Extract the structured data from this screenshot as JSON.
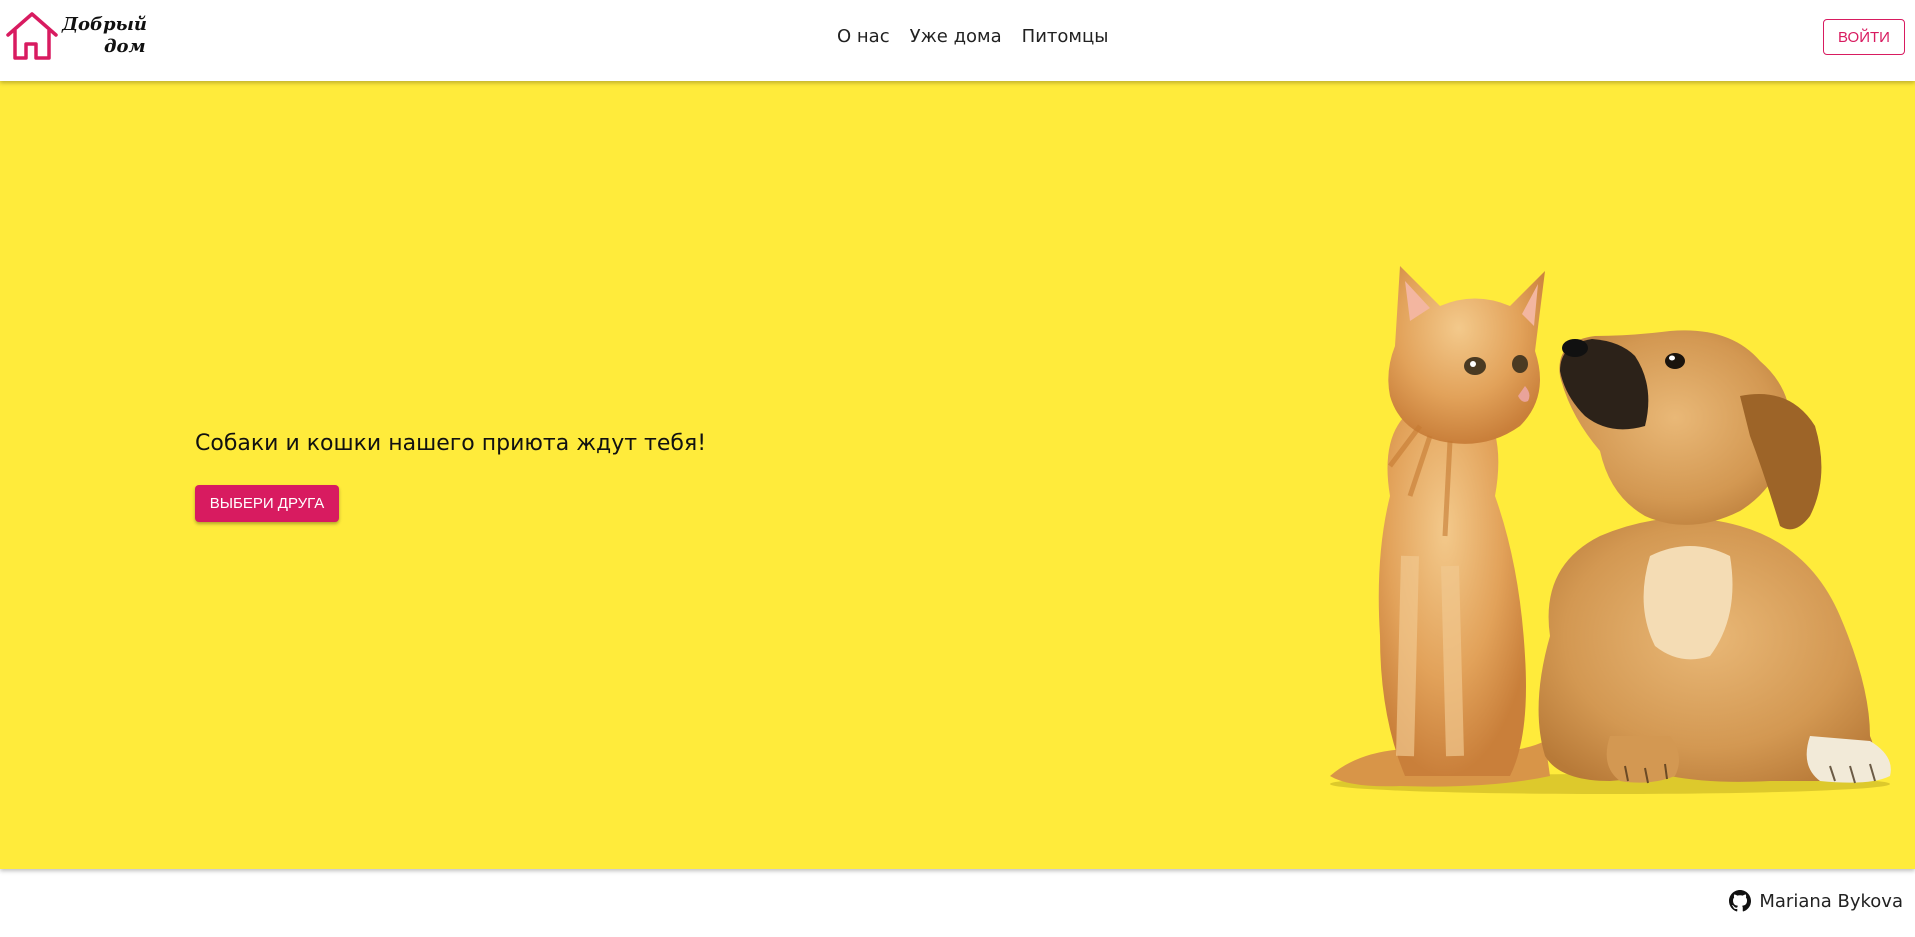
{
  "brand": {
    "line1": "Добрый",
    "line2": "дом",
    "color": "#d81b60"
  },
  "nav": {
    "items": [
      "О нас",
      "Уже дома",
      "Питомцы"
    ]
  },
  "header": {
    "login_label": "ВОЙТИ"
  },
  "hero": {
    "title": "Собаки и кошки нашего приюта ждут тебя!",
    "cta_label": "ВЫБЕРИ ДРУГА",
    "background": "#ffeb3b"
  },
  "footer": {
    "author": "Mariana Bykova",
    "icon": "github-icon"
  }
}
